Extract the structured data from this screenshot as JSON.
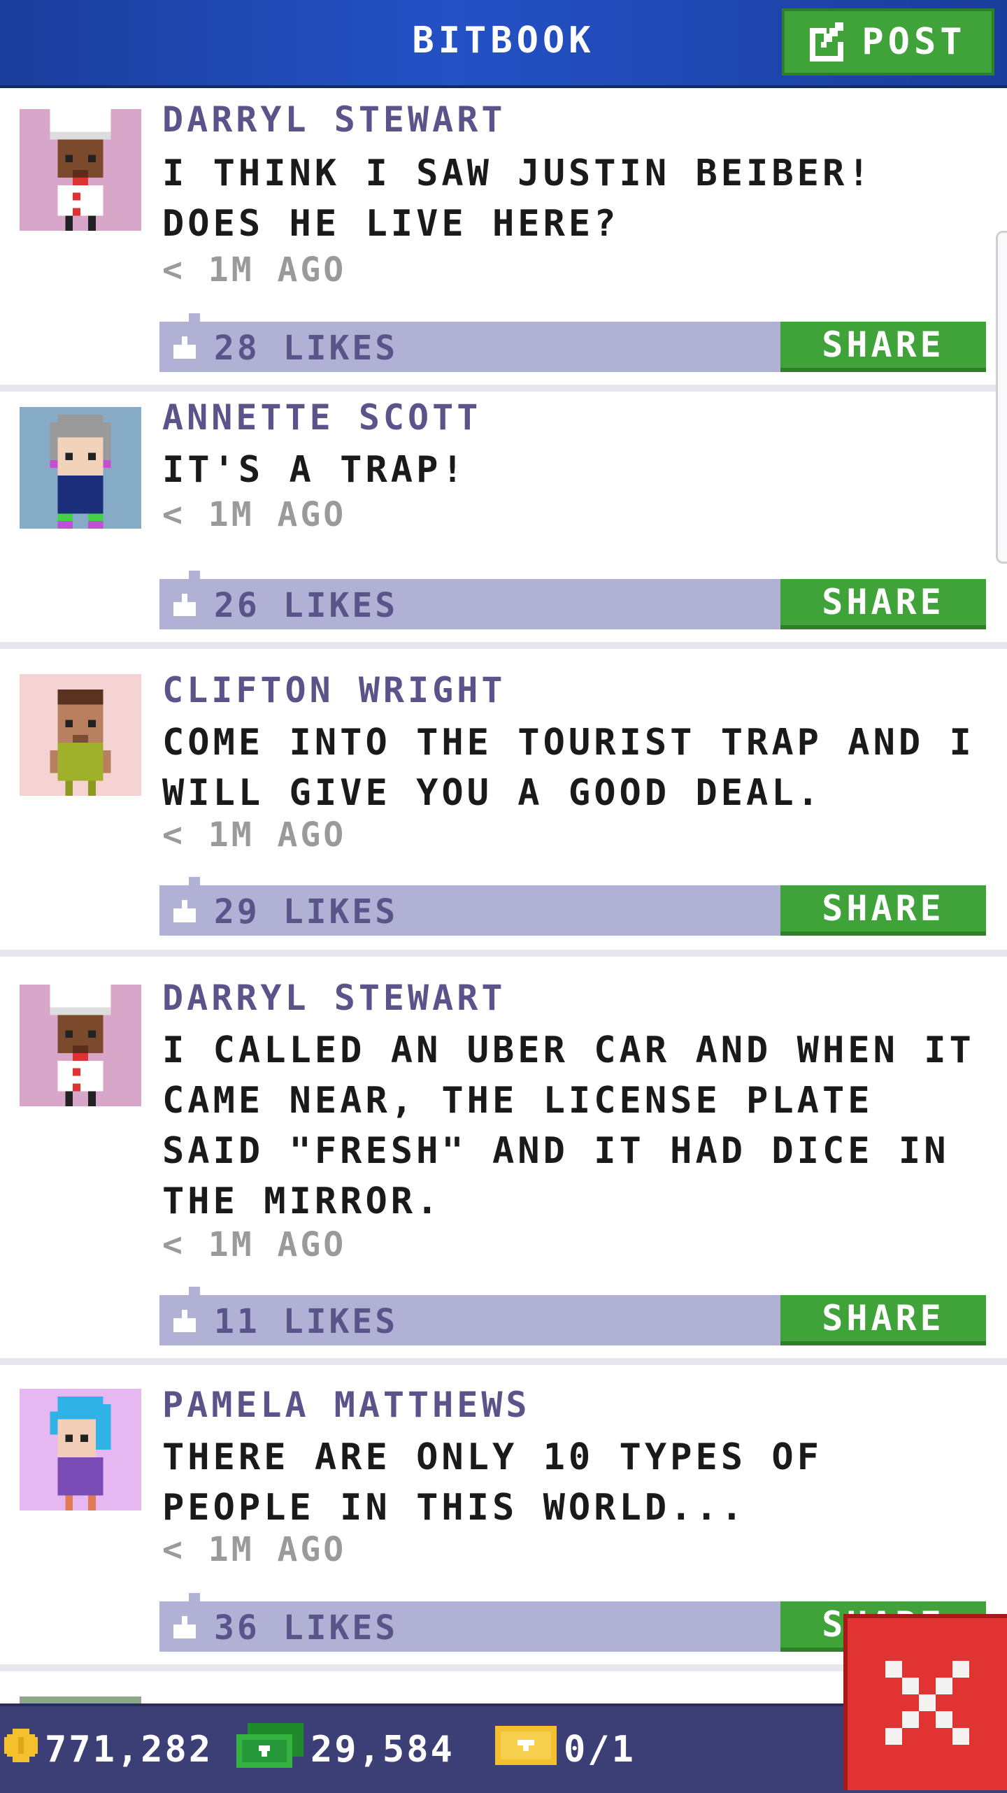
{
  "header": {
    "title": "BITBOOK",
    "post_label": "POST"
  },
  "posts": [
    {
      "author": "DARRYL STEWART",
      "message": "I THINK I SAW JUSTIN BEIBER! DOES HE LIVE HERE?",
      "time": "< 1M AGO",
      "likes": "28 LIKES",
      "share_label": "SHARE",
      "avatar_bg": "#d7a6c8",
      "avatar_icon": "chef-avatar-icon"
    },
    {
      "author": "ANNETTE SCOTT",
      "message": "IT'S A TRAP!",
      "time": "< 1M AGO",
      "likes": "26 LIKES",
      "share_label": "SHARE",
      "avatar_bg": "#86abc6",
      "avatar_icon": "grey-haired-woman-avatar-icon"
    },
    {
      "author": "CLIFTON WRIGHT",
      "message": "COME INTO THE TOURIST TRAP AND I WILL GIVE YOU A GOOD DEAL.",
      "time": "< 1M AGO",
      "likes": "29 LIKES",
      "share_label": "SHARE",
      "avatar_bg": "#f6d3d3",
      "avatar_icon": "man-green-shirt-avatar-icon"
    },
    {
      "author": "DARRYL STEWART",
      "message": "I CALLED AN UBER CAR AND WHEN IT CAME NEAR, THE LICENSE PLATE SAID \"FRESH\" AND IT HAD DICE IN THE MIRROR.",
      "time": "< 1M AGO",
      "likes": "11 LIKES",
      "share_label": "SHARE",
      "avatar_bg": "#d7a6c8",
      "avatar_icon": "chef-avatar-icon"
    },
    {
      "author": "PAMELA MATTHEWS",
      "message": "THERE ARE ONLY 10 TYPES OF PEOPLE IN THIS WORLD...",
      "time": "< 1M AGO",
      "likes": "36 LIKES",
      "share_label": "SHARE",
      "avatar_bg": "#e6b8f2",
      "avatar_icon": "blue-haired-woman-avatar-icon"
    }
  ],
  "footer": {
    "coins": "771,282",
    "bux": "29,584",
    "tickets": "0/1"
  },
  "colors": {
    "header_blue": "#2451c6",
    "share_green": "#3fa33a",
    "likes_bar": "#b1b1d5",
    "author_text": "#5a548a",
    "close_red": "#e23333"
  }
}
